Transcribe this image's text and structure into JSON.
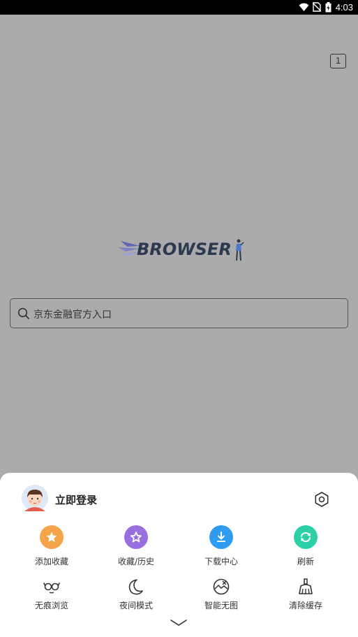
{
  "status_bar": {
    "time": "4:03",
    "icons": [
      "wifi-icon",
      "no-sim-icon",
      "battery-charging-icon"
    ]
  },
  "tab_counter": "1",
  "logo": {
    "text": "BROWSER"
  },
  "search": {
    "text": "京东金融官方入口"
  },
  "menu": {
    "login_label": "立即登录",
    "row1": [
      {
        "label": "添加收藏",
        "icon": "add-favorite-icon",
        "color": "#f5a44a"
      },
      {
        "label": "收藏/历史",
        "icon": "favorites-history-icon",
        "color": "#9b6ee0"
      },
      {
        "label": "下载中心",
        "icon": "download-icon",
        "color": "#2f9cf2"
      },
      {
        "label": "刷新",
        "icon": "refresh-icon",
        "color": "#2ccfa8"
      }
    ],
    "row2": [
      {
        "label": "无痕浏览",
        "icon": "incognito-icon"
      },
      {
        "label": "夜间模式",
        "icon": "night-mode-icon"
      },
      {
        "label": "智能无图",
        "icon": "no-image-icon"
      },
      {
        "label": "清除缓存",
        "icon": "clear-cache-icon"
      }
    ]
  },
  "colors": {
    "overlay_background": "#ababab",
    "sheet_background": "#ffffff"
  }
}
